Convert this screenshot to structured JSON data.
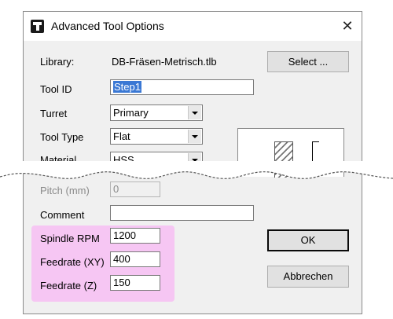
{
  "dialog": {
    "title": "Advanced Tool Options",
    "close_glyph": "✕",
    "icon": "app-icon"
  },
  "form": {
    "library_label": "Library:",
    "library_value": "DB-Fräsen-Metrisch.tlb",
    "select_button": "Select ...",
    "tool_id_label": "Tool ID",
    "tool_id_value": "Step1",
    "turret_label": "Turret",
    "turret_value": "Primary",
    "tool_type_label": "Tool Type",
    "tool_type_value": "Flat",
    "material_label": "Material",
    "material_value": "HSS",
    "pitch_label": "Pitch (mm)",
    "pitch_value": "0",
    "comment_label": "Comment",
    "comment_value": "",
    "spindle_label": "Spindle RPM",
    "spindle_value": "1200",
    "feed_xy_label": "Feedrate (XY)",
    "feed_xy_value": "400",
    "feed_z_label": "Feedrate (Z)",
    "feed_z_value": "150"
  },
  "buttons": {
    "ok": "OK",
    "cancel": "Abbrechen"
  },
  "colors": {
    "highlight": "#f6c6f3",
    "selection": "#3a78d4"
  }
}
